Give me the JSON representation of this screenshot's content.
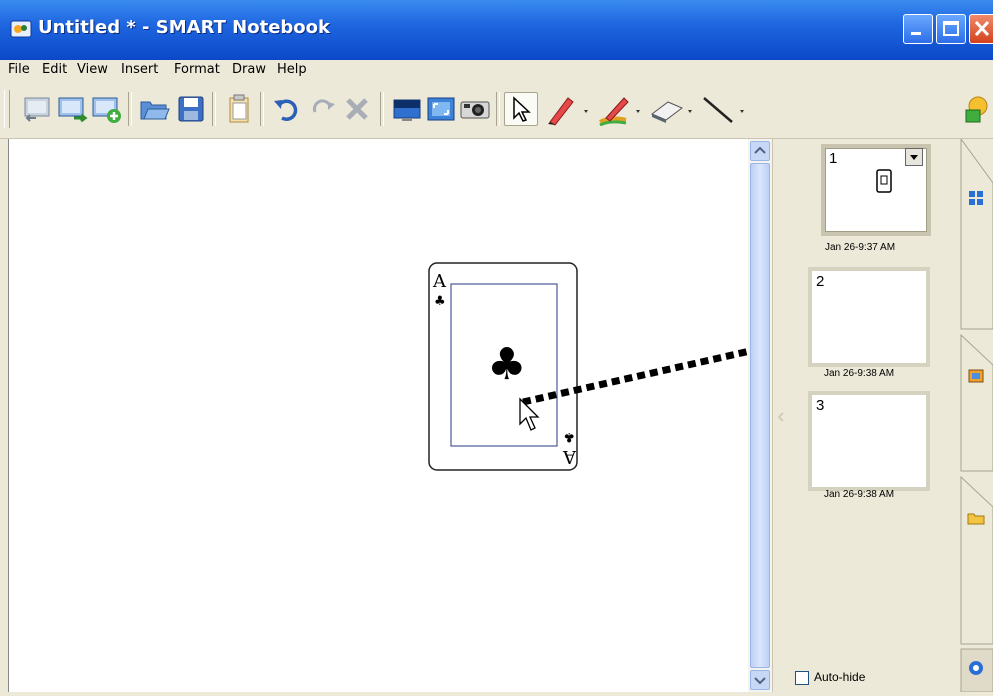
{
  "window": {
    "title": "Untitled * - SMART Notebook"
  },
  "menu": [
    "File",
    "Edit",
    "View",
    "Insert",
    "Format",
    "Draw",
    "Help"
  ],
  "toolbar": {
    "buttons": [
      "previous-page",
      "next-page",
      "add-page",
      "open",
      "save",
      "paste",
      "undo",
      "redo",
      "delete",
      "screen-shade",
      "full-screen",
      "screen-capture",
      "select",
      "pens",
      "creative-pens",
      "eraser",
      "lines",
      "shapes"
    ]
  },
  "card": {
    "rank": "A",
    "suit": "♣"
  },
  "page_sorter": {
    "pages": [
      {
        "number": "1",
        "date": "Jan 26-9:37 AM"
      },
      {
        "number": "2",
        "date": "Jan 26-9:38 AM"
      },
      {
        "number": "3",
        "date": "Jan 26-9:38 AM"
      }
    ],
    "auto_hide_label": "Auto-hide"
  },
  "colors": {
    "titlebar": "#0a48c8",
    "chrome": "#ece9d8",
    "arrow": "#000000"
  }
}
